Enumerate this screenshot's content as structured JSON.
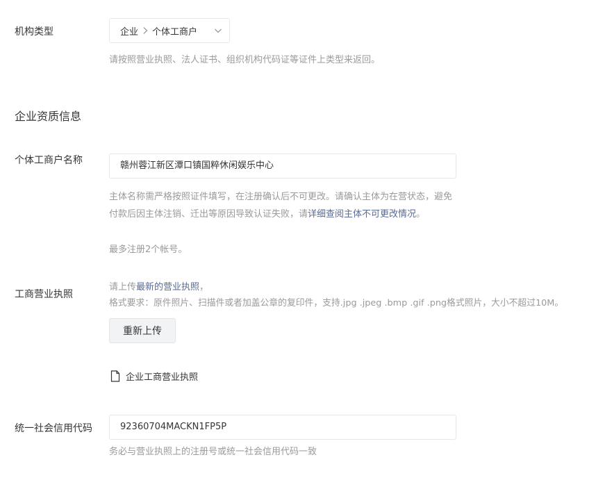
{
  "org_type": {
    "label": "机构类型",
    "level1": "企业",
    "level2": "个体工商户",
    "hint": "请按照营业执照、法人证书、组织机构代码证等证件上类型来返回。",
    "icons": {
      "separator": "chevron-right-icon",
      "dropdown": "chevron-down-icon"
    }
  },
  "qualification": {
    "section_title": "企业资质信息",
    "name_field": {
      "label": "个体工商户名称",
      "value": "赣州蓉江新区潭口镇国粹休闲娱乐中心",
      "hint_part1": "主体名称需严格按照证件填写，在注册确认后不可更改。请确认主体为在营状态，避免付款后因主体注销、迁出等原因导致认证失败，请",
      "hint_link": "详细查阅主体不可更改情况",
      "hint_end": "。",
      "limit_hint": "最多注册2个帐号。"
    },
    "license": {
      "label": "工商营业执照",
      "hint_prefix": "请上传",
      "hint_link": "最新的营业执照",
      "hint_suffix": "，",
      "format_hint": "格式要求：原件照片、扫描件或者加盖公章的复印件，支持.jpg .jpeg .bmp .gif .png格式照片，大小不超过10M。",
      "reupload_button": "重新上传",
      "file_name": "企业工商营业执照",
      "file_icon": "document-icon"
    },
    "credit_code": {
      "label": "统一社会信用代码",
      "value": "92360704MACKN1FP5P",
      "hint": "务必与营业执照上的注册号或统一社会信用代码一致"
    }
  },
  "colors": {
    "link": "#576b95",
    "hint": "#9a9a9a",
    "text": "#353535",
    "border": "#e4e8eb"
  }
}
